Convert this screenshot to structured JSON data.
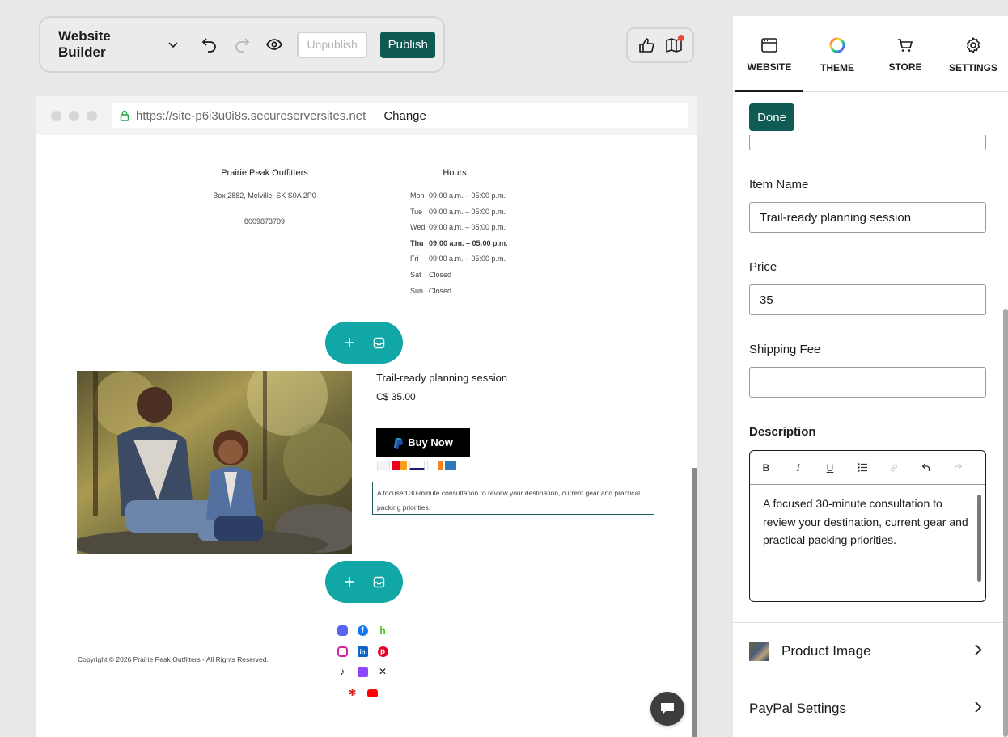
{
  "toolbar": {
    "brand": "Website Builder",
    "unpublish_label": "Unpublish",
    "publish_label": "Publish"
  },
  "browser": {
    "url": "https://site-p6i3u0i8s.secureserversites.net",
    "change_label": "Change"
  },
  "site": {
    "business": {
      "name": "Prairie Peak Outfitters",
      "address": "Box 2882, Melville, SK S0A 2P0",
      "phone": "8009873709"
    },
    "hours": {
      "title": "Hours",
      "rows": [
        {
          "day": "Mon",
          "time": "09:00 a.m. – 05:00 p.m."
        },
        {
          "day": "Tue",
          "time": "09:00 a.m. – 05:00 p.m."
        },
        {
          "day": "Wed",
          "time": "09:00 a.m. – 05:00 p.m."
        },
        {
          "day": "Thu",
          "time": "09:00 a.m. – 05:00 p.m."
        },
        {
          "day": "Fri",
          "time": "09:00 a.m. – 05:00 p.m."
        },
        {
          "day": "Sat",
          "time": "Closed"
        },
        {
          "day": "Sun",
          "time": "Closed"
        }
      ]
    },
    "product": {
      "title": "Trail-ready planning session",
      "price": "C$ 35.00",
      "buy_label": "Buy Now",
      "description": "A focused 30-minute consultation to review your destination, current gear and practical packing priorities."
    },
    "copyright": "Copyright © 2026 Prairie Peak Outfitters - All Rights Reserved.",
    "socials": [
      "discord-icon",
      "facebook-icon",
      "houzz-icon",
      "instagram-icon",
      "linkedin-icon",
      "pinterest-icon",
      "tiktok-icon",
      "twitch-icon",
      "x-icon",
      "yelp-icon",
      "youtube-icon"
    ]
  },
  "panel": {
    "tabs": [
      {
        "label": "WEBSITE"
      },
      {
        "label": "THEME"
      },
      {
        "label": "STORE"
      },
      {
        "label": "SETTINGS"
      }
    ],
    "done_label": "Done",
    "item_name_label": "Item Name",
    "item_name_value": "Trail-ready planning session",
    "price_label": "Price",
    "price_value": "35",
    "shipping_label": "Shipping Fee",
    "shipping_value": "",
    "description_label": "Description",
    "description_value": "A focused 30-minute consultation to review your destination, current gear and practical packing priorities.",
    "product_image_label": "Product Image",
    "paypal_label": "PayPal Settings"
  },
  "colors": {
    "accent": "#0f5a53",
    "pill": "#10a7a6"
  }
}
